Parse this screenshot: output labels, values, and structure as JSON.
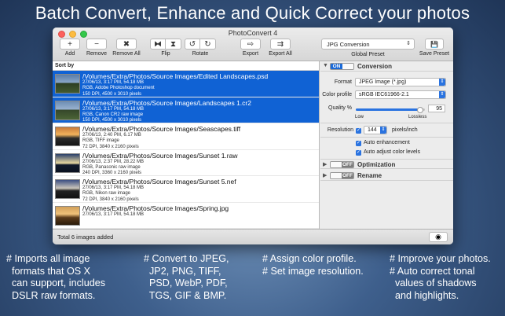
{
  "banner": {
    "title": "Batch Convert, Enhance and Quick Correct your photos"
  },
  "window": {
    "title": "PhotoConvert 4"
  },
  "toolbar": {
    "add": {
      "icon": "+",
      "label": "Add"
    },
    "remove": {
      "icon": "−",
      "label": "Remove"
    },
    "remove_all": {
      "icon": "✖",
      "label": "Remove All"
    },
    "flip": {
      "icon_a": "⧓",
      "icon_b": "⧗",
      "label": "Flip"
    },
    "rotate": {
      "icon_a": "↺",
      "icon_b": "↻",
      "label": "Rotate"
    },
    "export": {
      "icon": "⇨",
      "label": "Export"
    },
    "export_all": {
      "icon": "⇉",
      "label": "Export All"
    },
    "preset_value": "JPG Conversion",
    "preset_label": "Global Preset",
    "save_preset": {
      "icon": "💾",
      "label": "Save Preset"
    }
  },
  "list": {
    "sort_label": "Sort by",
    "items": [
      {
        "path": "/Volumes/Extra/Photos/Source Images/Edited Landscapes.psd",
        "line1": "27/06/13, 3:17 PM, 54.18 MB",
        "line2": "RGB, Adobe Photoshop document",
        "line3": "150 DPI, 4500 x 3010 pixels",
        "selected": true
      },
      {
        "path": "/Volumes/Extra/Photos/Source Images/Landscapes 1.cr2",
        "line1": "27/06/13, 3:17 PM, 54.18 MB",
        "line2": "RGB, Canon CR2 raw image",
        "line3": "150 DPI, 4500 x 3010 pixels",
        "selected": true
      },
      {
        "path": "/Volumes/Extra/Photos/Source Images/Seascapes.tiff",
        "line1": "27/06/13, 2:40 PM, 6.17 MB",
        "line2": "RGB, TIFF image",
        "line3": "72 DPI, 3840 x 2160 pixels",
        "selected": false
      },
      {
        "path": "/Volumes/Extra/Photos/Source Images/Sunset 1.raw",
        "line1": "27/06/13, 2:37 PM, 28.22 MB",
        "line2": "RGB, Panasonic raw image",
        "line3": "240 DPI, 3360 x 2160 pixels",
        "selected": false
      },
      {
        "path": "/Volumes/Extra/Photos/Source Images/Sunset 5.nef",
        "line1": "27/06/13, 3:17 PM, 54.18 MB",
        "line2": "RGB, Nikon raw image",
        "line3": "72 DPI, 3840 x 2160 pixels",
        "selected": false
      },
      {
        "path": "/Volumes/Extra/Photos/Source Images/Spring.jpg",
        "line1": "27/06/13, 3:17 PM, 54.18 MB",
        "line2": "",
        "line3": "",
        "selected": false
      }
    ]
  },
  "panel": {
    "conversion": {
      "toggle": "ON",
      "title": "Conversion"
    },
    "format_label": "Format",
    "format_value": "JPEG Image (*.jpg)",
    "profile_label": "Color profile",
    "profile_value": "sRGB IEC61966-2.1",
    "quality_label": "Quality %",
    "quality_value": "95",
    "quality_level": 0.93,
    "low_label": "Low",
    "lossless_label": "Lossless",
    "resolution_label": "Resolution",
    "resolution_value": "144",
    "resolution_unit": "pixels/inch",
    "auto_enhance": "Auto enhancement",
    "auto_levels": "Auto adjust color levels",
    "optimization": {
      "toggle": "OFF",
      "title": "Optimization"
    },
    "rename": {
      "toggle": "OFF",
      "title": "Rename"
    }
  },
  "status": {
    "text": "Total 6 images added"
  },
  "features": [
    {
      "lines": [
        "# Imports all image",
        "  formats that OS X",
        "  can support, includes",
        "  DSLR raw formats."
      ]
    },
    {
      "lines": [
        "# Convert to JPEG,",
        "  JP2, PNG, TIFF,",
        "  PSD, WebP, PDF,",
        "  TGS, GIF & BMP."
      ]
    },
    {
      "lines": [
        "# Assign color profile.",
        "# Set image resolution."
      ]
    },
    {
      "lines": [
        "# Improve your photos.",
        "# Auto correct tonal",
        "  values of shadows",
        "  and highlights."
      ]
    }
  ]
}
